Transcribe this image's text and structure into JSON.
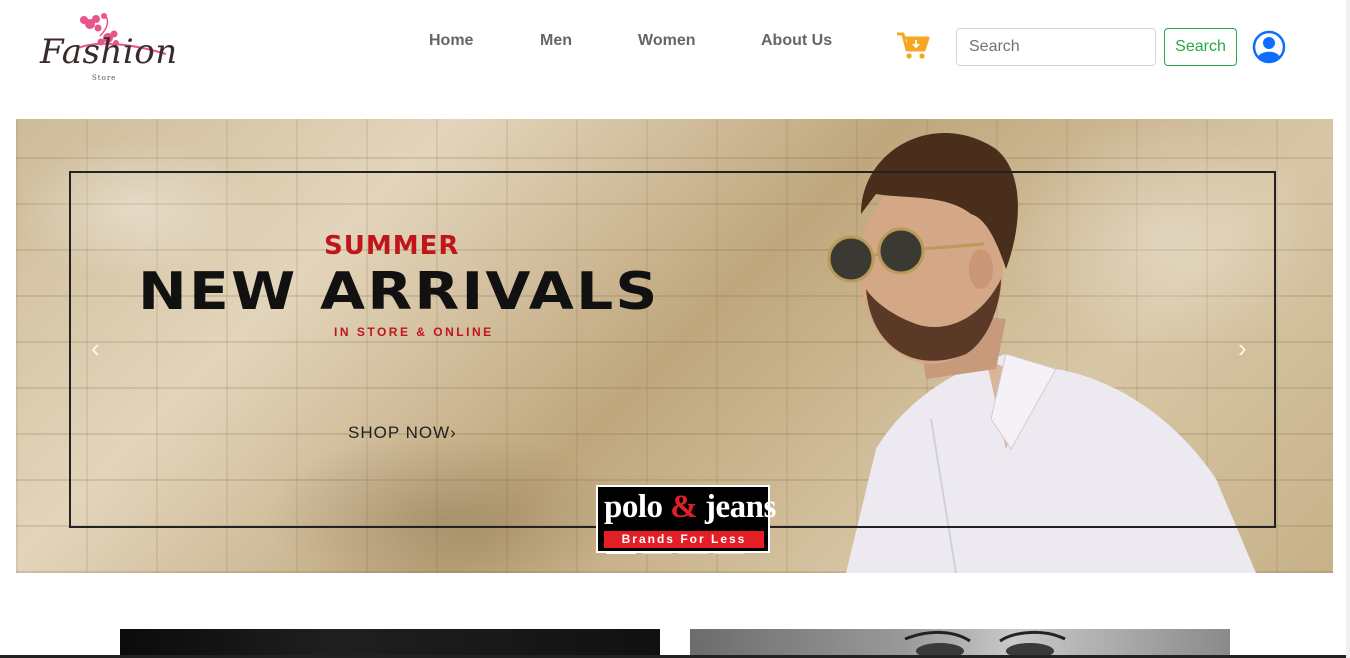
{
  "header": {
    "logo": {
      "text": "Fashion",
      "subtext": "Store"
    },
    "nav": [
      {
        "label": "Home"
      },
      {
        "label": "Men"
      },
      {
        "label": "Women"
      },
      {
        "label": "About Us"
      }
    ],
    "search": {
      "placeholder": "Search",
      "value": "",
      "button_label": "Search"
    },
    "icons": {
      "cart": "cart-icon",
      "user": "user-circle-icon"
    }
  },
  "hero": {
    "headline_top": "SUMMER",
    "headline_main": "NEW ARRIVALS",
    "tagline": "IN STORE & ONLINE",
    "cta": "SHOP NOW›",
    "brand": {
      "name_part1": "polo",
      "amp": "&",
      "name_part2": "jeans",
      "slogan": "Brands For Less"
    },
    "prev_icon": "‹",
    "next_icon": "›",
    "slides": 4,
    "active_slide": 0
  },
  "colors": {
    "accent_red": "#c0151b",
    "search_green": "#28a745",
    "user_blue": "#0d6efd",
    "cart_orange": "#f5a623",
    "logo_pink": "#e8558a"
  }
}
